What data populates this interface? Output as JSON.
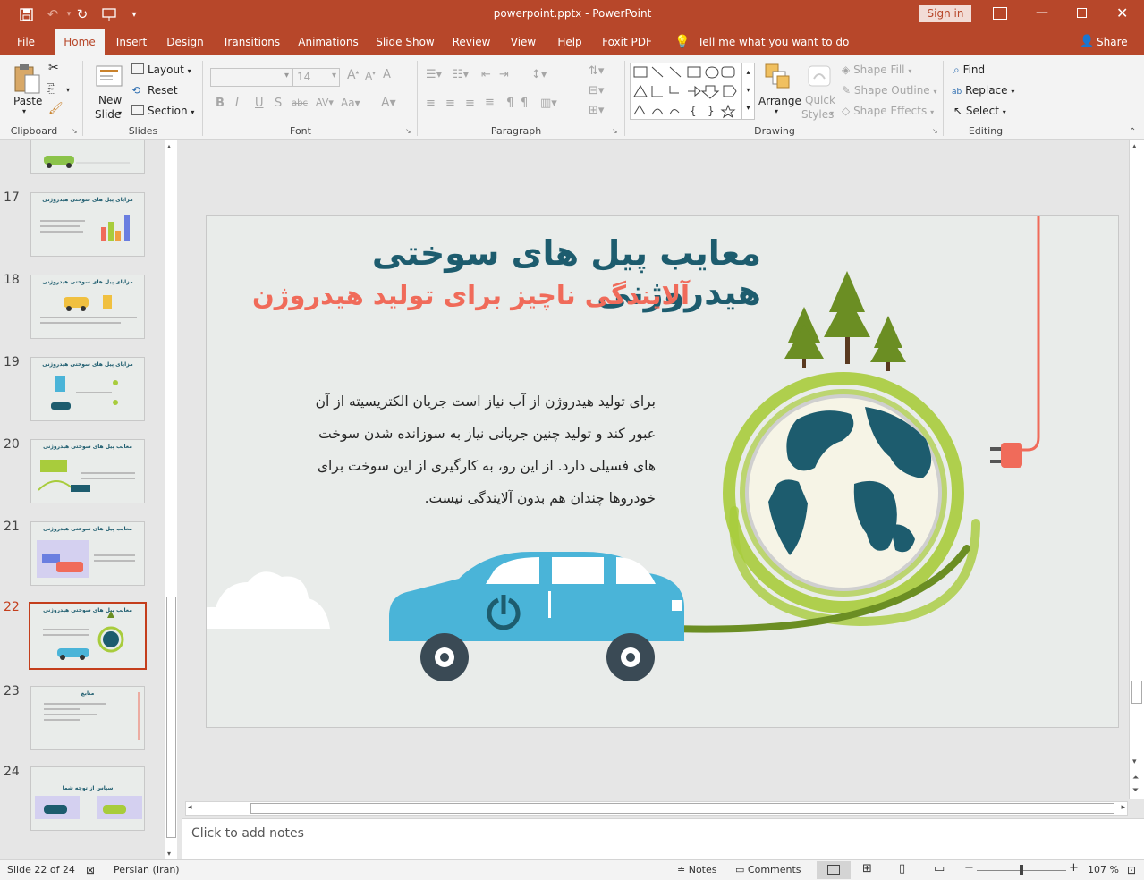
{
  "window": {
    "title": "powerpoint.pptx - PowerPoint",
    "sign_in": "Sign in"
  },
  "tabs": [
    "File",
    "Home",
    "Insert",
    "Design",
    "Transitions",
    "Animations",
    "Slide Show",
    "Review",
    "View",
    "Help",
    "Foxit PDF"
  ],
  "tell_me": "Tell me what you want to do",
  "share": "Share",
  "ribbon": {
    "clipboard": {
      "label": "Clipboard",
      "paste": "Paste"
    },
    "slides": {
      "label": "Slides",
      "new_slide_1": "New",
      "new_slide_2": "Slide",
      "layout": "Layout",
      "reset": "Reset",
      "section": "Section"
    },
    "font": {
      "label": "Font",
      "size": "14"
    },
    "paragraph": {
      "label": "Paragraph"
    },
    "drawing": {
      "label": "Drawing",
      "arrange": "Arrange",
      "quick_styles_1": "Quick",
      "quick_styles_2": "Styles",
      "shape_fill": "Shape Fill",
      "shape_outline": "Shape Outline",
      "shape_effects": "Shape Effects"
    },
    "editing": {
      "label": "Editing",
      "find": "Find",
      "replace": "Replace",
      "select": "Select"
    }
  },
  "thumbnails": [
    {
      "num": "17",
      "title": "مزایای پیل های سوختی هیدروژنی"
    },
    {
      "num": "18",
      "title": "مزایای پیل های سوختی هیدروژنی"
    },
    {
      "num": "19",
      "title": "مزایای پیل های سوختی هیدروژنی"
    },
    {
      "num": "20",
      "title": "معایب پیل های سوختی هیدروژنی"
    },
    {
      "num": "21",
      "title": "معایب پیل های سوختی هیدروژنی"
    },
    {
      "num": "22",
      "title": "معایب پیل های سوختی هیدروژنی"
    },
    {
      "num": "23",
      "title": "منابع"
    },
    {
      "num": "24",
      "title": "سپاس از توجه شما"
    }
  ],
  "selected_slide": "22",
  "slide": {
    "title": "معایب پیل های سوختی هیدروژنی",
    "subtitle": "آلایندگی ناچیز برای تولید هیدروژن",
    "body_lines": [
      "برای تولید هیدروژن از آب نیاز است جریان الکتریسیته از آن",
      "عبور کند و تولید چنین جریانی نیاز به سوزانده شدن سوخت",
      "های فسیلی دارد. از این رو، به کارگیری از این سوخت برای",
      "خودروها چندان هم بدون آلایندگی نیست."
    ]
  },
  "notes_placeholder": "Click to add notes",
  "status": {
    "slide_info": "Slide 22 of 24",
    "language": "Persian (Iran)",
    "notes": "Notes",
    "comments": "Comments",
    "zoom": "107 %"
  },
  "colors": {
    "accent": "#b7472a",
    "title": "#1d5c6e",
    "subtitle": "#f06b5a",
    "car": "#4ab4d8",
    "green": "#a8cc3c",
    "tree": "#6b8e23"
  }
}
